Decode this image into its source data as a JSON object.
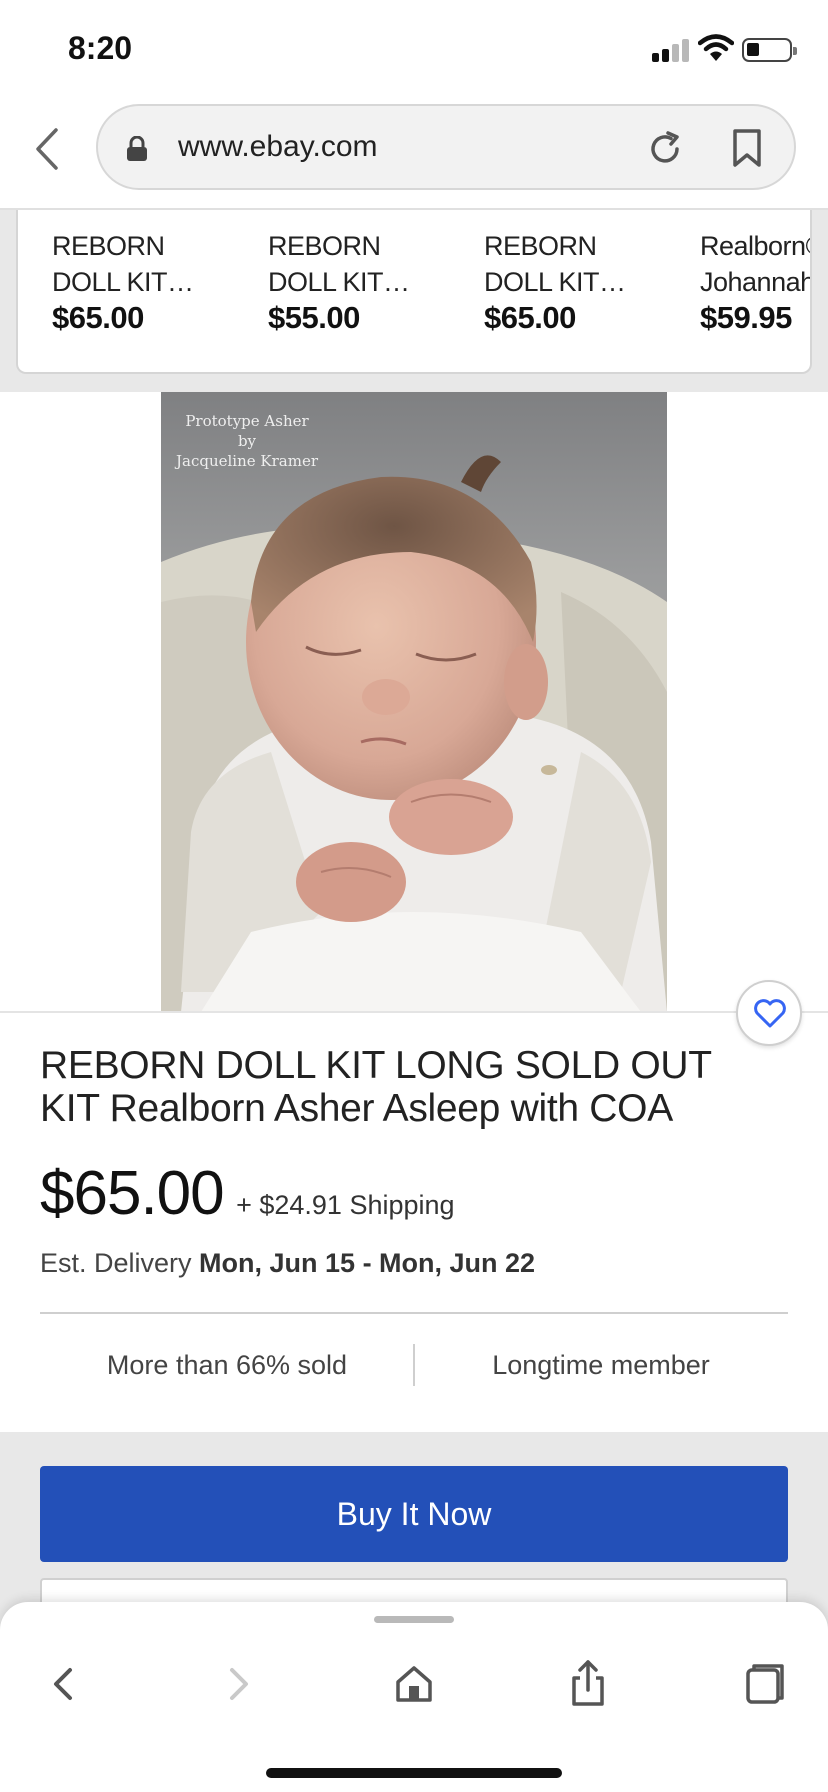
{
  "status_bar": {
    "time": "8:20"
  },
  "browser": {
    "url": "www.ebay.com"
  },
  "carousel": {
    "items": [
      {
        "title_line1": "REBORN",
        "title_line2": "DOLL KIT…",
        "price": "$65.00"
      },
      {
        "title_line1": "REBORN",
        "title_line2": "DOLL KIT…",
        "price": "$55.00"
      },
      {
        "title_line1": "REBORN",
        "title_line2": "DOLL KIT…",
        "price": "$65.00"
      },
      {
        "title_line1": "Realborn©",
        "title_line2": "Johannah",
        "price": "$59.95"
      }
    ]
  },
  "image": {
    "caption_line1": "Prototype Asher",
    "caption_line2": "by",
    "caption_line3": "Jacqueline Kramer"
  },
  "listing": {
    "title": "REBORN DOLL KIT LONG SOLD OUT KIT Realborn Asher Asleep with COA",
    "price": "$65.00",
    "shipping": "+ $24.91 Shipping",
    "delivery_label": "Est. Delivery ",
    "delivery_dates": "Mon, Jun 15 - Mon, Jun 22",
    "signal_left": "More than 66% sold",
    "signal_right": "Longtime member"
  },
  "actions": {
    "buy_now": "Buy It Now"
  },
  "colors": {
    "accent": "#2350b8",
    "watch_icon": "#3665f3"
  },
  "toolbar": {
    "icons": [
      "back-icon",
      "forward-icon",
      "home-icon",
      "share-icon",
      "tabs-icon"
    ]
  }
}
